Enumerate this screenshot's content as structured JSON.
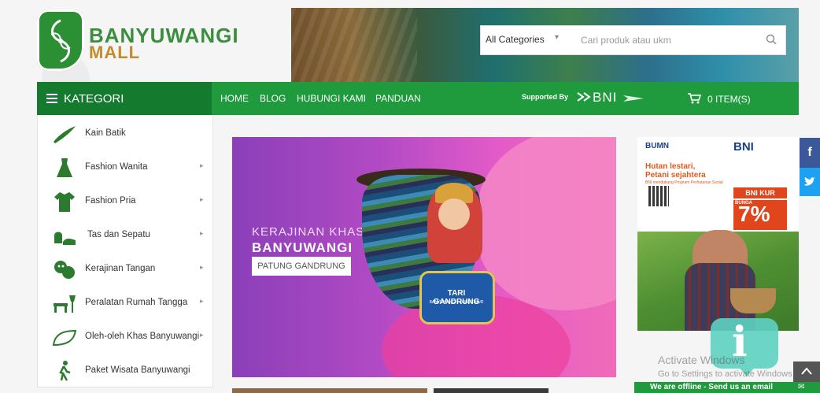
{
  "header": {
    "logo_line1": "BANYUWANGI",
    "logo_line2": "MALL",
    "search": {
      "category": "All Categories",
      "placeholder": "Cari produk atau ukm"
    }
  },
  "nav": {
    "kategori_label": "KATEGORI",
    "links": [
      "HOME",
      "BLOG",
      "HUBUNGI KAMI",
      "PANDUAN"
    ],
    "supported_by": "Supported By",
    "bni": "BNI",
    "cart_label": "0 ITEM(S)"
  },
  "sidebar": {
    "items": [
      {
        "label": "Kain Batik",
        "has_sub": false,
        "icon": "batik-icon"
      },
      {
        "label": "Fashion Wanita",
        "has_sub": true,
        "icon": "dress-icon"
      },
      {
        "label": "Fashion Pria",
        "has_sub": true,
        "icon": "shirt-icon"
      },
      {
        "label": "Tas dan Sepatu",
        "has_sub": true,
        "icon": "bag-shoe-icon"
      },
      {
        "label": "Kerajinan Tangan",
        "has_sub": true,
        "icon": "mask-icon"
      },
      {
        "label": "Peralatan Rumah Tangga",
        "has_sub": true,
        "icon": "furniture-icon"
      },
      {
        "label": "Oleh-oleh Khas Banyuwangi",
        "has_sub": true,
        "icon": "gift-icon"
      },
      {
        "label": "Paket Wisata Banyuwangi",
        "has_sub": false,
        "icon": "hiker-icon"
      }
    ]
  },
  "hero": {
    "line1": "KERAJINAN KHAS",
    "line2": "BANYUWANGI",
    "button": "PATUNG GANDRUNG",
    "drum_text": "TARI GANDRUNG",
    "drum_sub": "BANYUWANGI - JAWA TIMUR"
  },
  "ad": {
    "bumn": "BUMN",
    "bni": "BNI",
    "title_line1": "Hutan lestari,",
    "title_line2": "Petani sejahtera",
    "small": "BNI mendukung Program Perhutanan Sosial",
    "kur": "BNI KUR",
    "bunga": "BUNGA",
    "rate": "7%"
  },
  "overlay": {
    "activate_title": "Activate Windows",
    "activate_sub": "Go to Settings to activate Windows.",
    "offline": "We are offline - Send us an email"
  },
  "colors": {
    "primary_green": "#1f9a3d",
    "dark_green": "#137a2e"
  }
}
